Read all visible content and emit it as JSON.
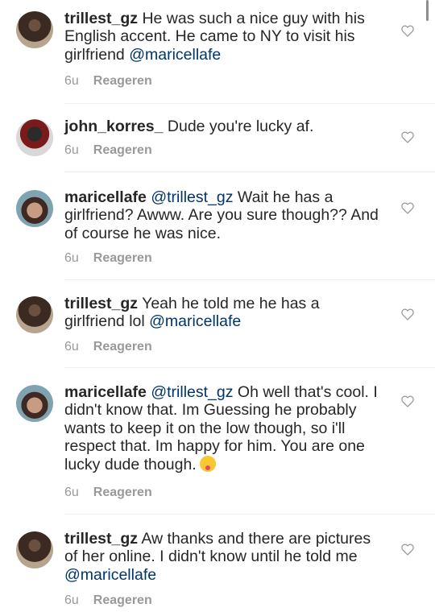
{
  "comments": [
    {
      "username": "trillest_gz",
      "text": "He was such a nice guy with his English accent. He came to NY to visit his girlfriend ",
      "mention": "@maricellafe",
      "time": "6u",
      "reply": "Reageren"
    },
    {
      "username": "john_korres_",
      "text": "Dude you're lucky af.",
      "time": "6u",
      "reply": "Reageren"
    },
    {
      "username": "maricellafe",
      "mention": "@trillest_gz",
      "text": "Wait he has a girlfriend? Awww. Are you sure though?? And of course he was nice.",
      "time": "6u",
      "reply": "Reageren"
    },
    {
      "username": "trillest_gz",
      "text": "Yeah he told me he has a girlfriend lol ",
      "mention": "@maricellafe",
      "time": "6u",
      "reply": "Reageren"
    },
    {
      "username": "maricellafe",
      "mention": "@trillest_gz",
      "text": "Oh well that's cool. I didn't know that. Im Guessing he probably wants to keep it on the low though, so i'll respect that. Im happy for him. You are one lucky dude though.",
      "emoji": "tongue-out-emoji",
      "time": "6u",
      "reply": "Reageren"
    },
    {
      "username": "trillest_gz",
      "text": "Aw thanks and there are pictures of her online. I didn't know until he told me ",
      "mention": "@maricellafe",
      "time": "6u",
      "reply": "Reageren"
    }
  ],
  "icons": {
    "like": "heart-outline-icon"
  }
}
